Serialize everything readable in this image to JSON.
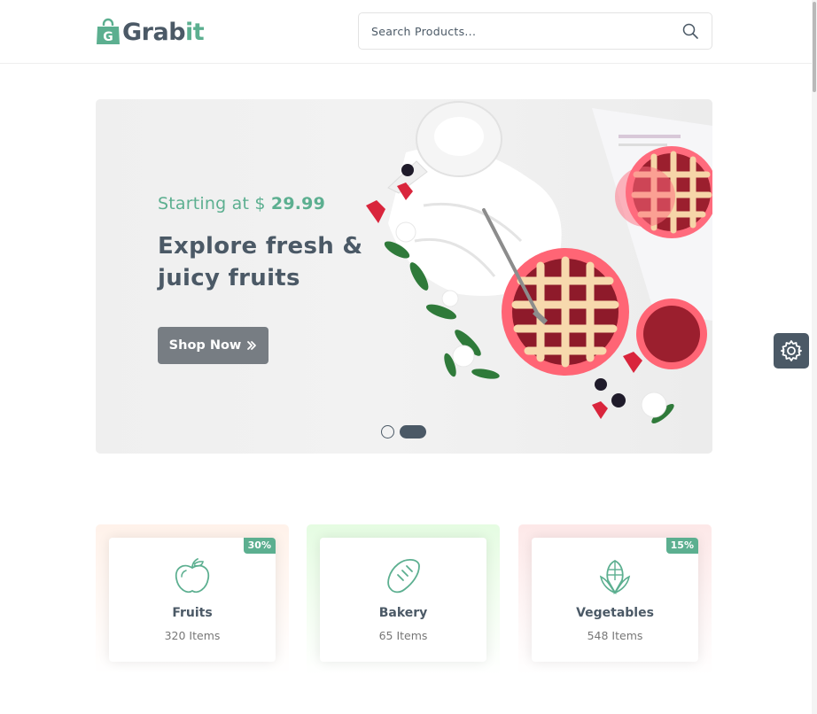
{
  "header": {
    "logo": {
      "grab": "Grab",
      "it": "it"
    },
    "search": {
      "placeholder": "Search Products..."
    }
  },
  "hero": {
    "subtitle_prefix": "Starting at $",
    "subtitle_price": "29.99",
    "title": "Explore fresh & juicy fruits",
    "button_label": "Shop Now",
    "slides": 2,
    "active_slide": 2
  },
  "categories": [
    {
      "name": "Fruits",
      "count": "320 Items",
      "badge": "30%",
      "icon": "apple-icon"
    },
    {
      "name": "Bakery",
      "count": "65 Items",
      "badge": "",
      "icon": "bread-icon"
    },
    {
      "name": "Vegetables",
      "count": "548 Items",
      "badge": "15%",
      "icon": "corn-icon"
    }
  ],
  "colors": {
    "brand": "#5caf90",
    "text": "#4b5966",
    "fruits_bg": "#fff2ea",
    "bakery_bg": "#e7fce4",
    "vegetables_bg": "#fde9e9"
  },
  "icons": {
    "search": "search-icon",
    "settings": "gear-icon",
    "shop_now": "double-chevron-right-icon",
    "logo": "shopping-bag-icon"
  }
}
